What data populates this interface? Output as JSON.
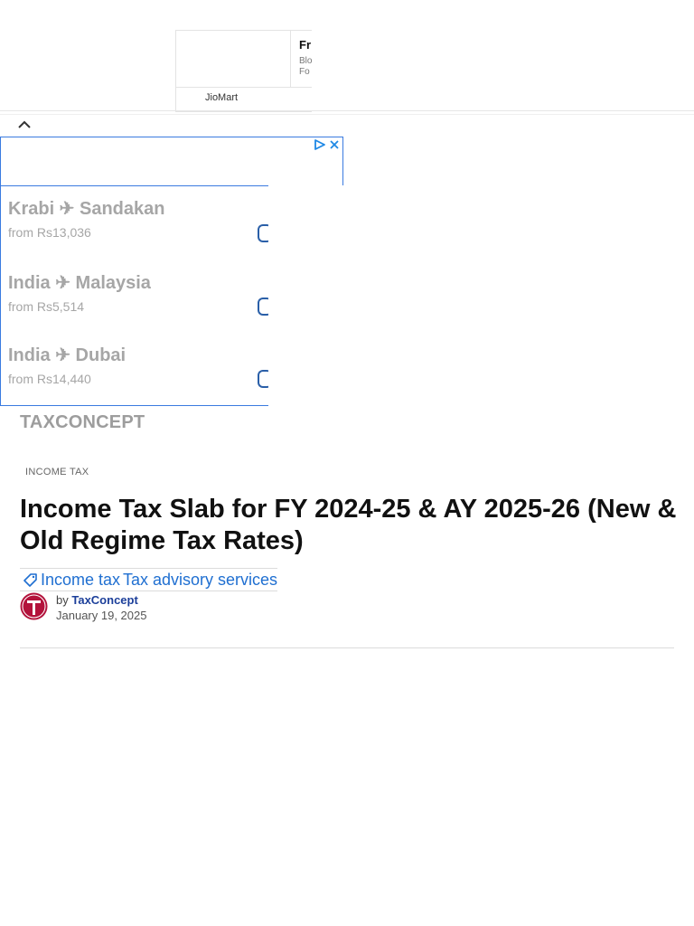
{
  "top_ad": {
    "headline": "Fr",
    "sub_line1": "Blo",
    "sub_line2": "Fo",
    "brand": "JioMart"
  },
  "flight_ad": {
    "routes": [
      {
        "title": "Krabi ✈ Sandakan",
        "price": "from Rs13,036"
      },
      {
        "title": "India ✈ Malaysia",
        "price": "from Rs5,514"
      },
      {
        "title": "India ✈ Dubai",
        "price": "from Rs14,440"
      }
    ],
    "accent": "#3a7be0"
  },
  "site": {
    "name": "TAXCONCEPT"
  },
  "article": {
    "category": "INCOME TAX",
    "title": "Income Tax Slab for FY 2024-25 & AY 2025-26 (New & Old Regime Tax Rates)",
    "tags": [
      "Income tax",
      "Tax advisory services"
    ],
    "by_prefix": "by",
    "author": "TaxConcept",
    "date": "January 19, 2025"
  },
  "colors": {
    "link": "#1f6fd1",
    "author": "#1c3f9a",
    "avatar": "#b3123b"
  }
}
